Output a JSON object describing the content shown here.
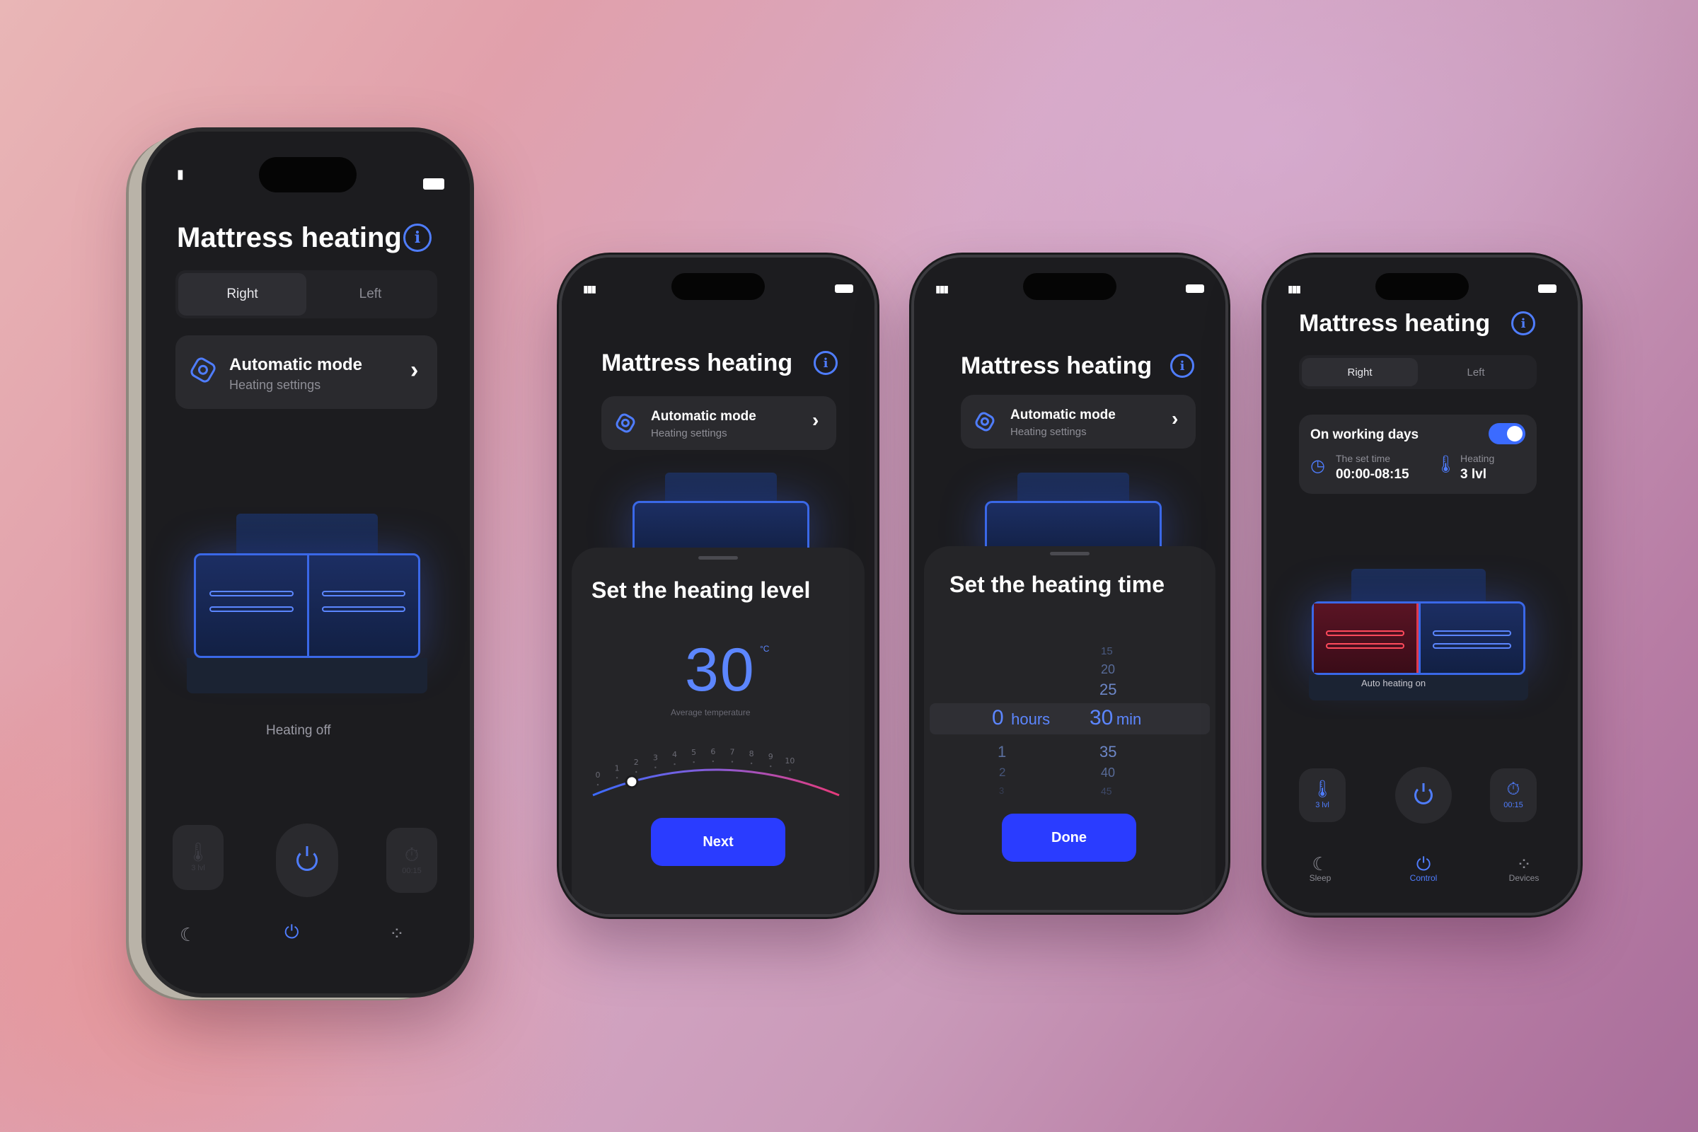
{
  "app": {
    "title": "Mattress heating",
    "info_icon": "info-icon"
  },
  "sides": {
    "right": "Right",
    "left": "Left",
    "selected": "Right"
  },
  "mode_card": {
    "title": "Automatic mode",
    "subtitle": "Heating settings",
    "chevron": "›"
  },
  "screen1": {
    "bed_caption": "Heating off",
    "temp_btn": "3 lvl",
    "timer_btn": "00:15"
  },
  "screen2": {
    "sheet_title": "Set the heating level",
    "temperature": "30",
    "unit": "°C",
    "temperature_caption": "Average temperature",
    "level": 1,
    "scale": [
      "0",
      "1",
      "2",
      "3",
      "4",
      "5",
      "6",
      "7",
      "8",
      "9",
      "10"
    ],
    "next_label": "Next"
  },
  "screen3": {
    "sheet_title": "Set the heating time",
    "hours_above": [],
    "hours_selected": "0",
    "hours_unit": "hours",
    "hours_below": [
      "1",
      "2",
      "3"
    ],
    "minutes_above": [
      "15",
      "20",
      "25"
    ],
    "minutes_selected": "30",
    "minutes_unit": "min",
    "minutes_below": [
      "35",
      "40",
      "45"
    ],
    "done_label": "Done"
  },
  "screen4": {
    "schedule_title": "On working days",
    "schedule_enabled": true,
    "time_label": "The set time",
    "time_value": "00:00-08:15",
    "heat_label": "Heating",
    "heat_value": "3 lvl",
    "bed_caption": "Auto heating on",
    "temp_btn": "3 lvl",
    "timer_btn": "00:15"
  },
  "nav": {
    "sleep": "Sleep",
    "control": "Control",
    "devices": "Devices",
    "selected": "Control"
  },
  "colors": {
    "accent": "#4f7dff",
    "button": "#2a3cff",
    "heat": "#e0394f"
  }
}
